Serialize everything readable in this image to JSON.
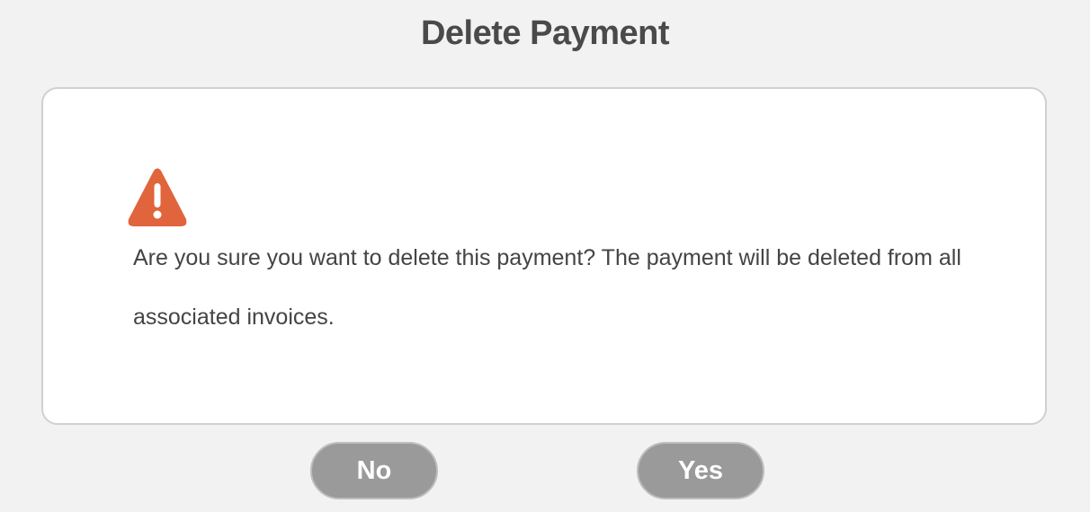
{
  "dialog": {
    "title": "Delete Payment",
    "message": "Are you sure you want to delete this payment? The payment will be deleted from all associated invoices.",
    "icon": "warning-triangle-icon",
    "no_label": "No",
    "yes_label": "Yes"
  },
  "colors": {
    "warning": "#e0643c",
    "button": "#9a9a9a",
    "background": "#f2f2f2"
  }
}
